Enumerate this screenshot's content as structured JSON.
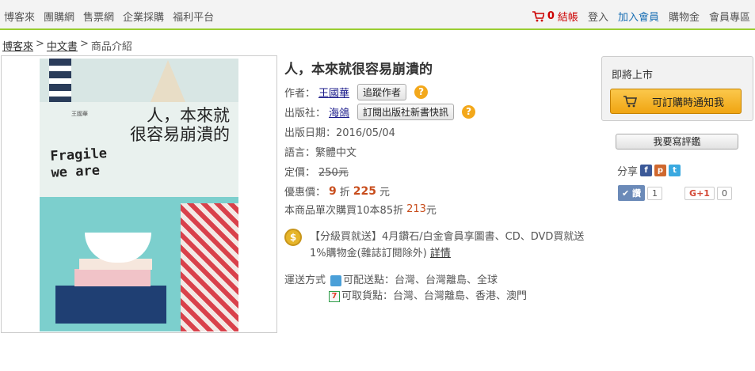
{
  "topnav": [
    "博客來",
    "團購網",
    "售票網",
    "企業採購",
    "福利平台"
  ],
  "usernav": {
    "cart_count": "0",
    "checkout": "結帳",
    "login": "登入",
    "join": "加入會員",
    "points": "購物金",
    "member_zone": "會員專區"
  },
  "breadcrumb": {
    "home": "博客來",
    "category": "中文書",
    "current": "商品介紹",
    "sep": ">"
  },
  "cover": {
    "title_line1": "人，本來就",
    "title_line2": "很容易崩潰的",
    "author": "王國華",
    "fragile_line1": "Fragile",
    "fragile_line2": "we are"
  },
  "product": {
    "title": "人，本來就很容易崩潰的",
    "author_label": "作者：",
    "author": "王國華",
    "track_author": "追蹤作者",
    "publisher_label": "出版社：",
    "publisher": "海鴿",
    "subscribe_publisher": "訂閱出版社新書快訊",
    "pubdate": "出版日期：2016/05/04",
    "language": "語言：繁體中文",
    "list_price_label": "定價：",
    "list_price": "250元",
    "sale_label": "優惠價：",
    "discount": "9",
    "discount_unit": "折",
    "sale_price": "225",
    "sale_unit": "元",
    "bulk_prefix": "本商品單次購買10本85折",
    "bulk_price": "213",
    "bulk_unit": "元",
    "help": "?"
  },
  "promo": {
    "coin": "$",
    "line1": "【分級買就送】4月鑽石/白金會員享圖書、CD、DVD買就送",
    "line2": "1%購物金(雜誌訂閱除外)",
    "details": "詳情"
  },
  "shipping": {
    "label": "運送方式",
    "delivery": "可配送點：台灣、台灣離島、全球",
    "pickup": "可取貨點：台灣、台灣離島、香港、澳門",
    "seven": "7"
  },
  "panel": {
    "title": "即將上市",
    "notify": "可訂購時通知我"
  },
  "review_button": "我要寫評鑑",
  "share": {
    "label": "分享",
    "fb": "f",
    "plurk": "p",
    "tw": "t"
  },
  "social": {
    "like_label": "✔ 讚",
    "like_count": "1",
    "gplus_label": "G+1",
    "gplus_count": "0"
  },
  "colors": {
    "accent_green": "#9acd32",
    "sale_orange": "#c84d1c",
    "notify_button": "#f0a512"
  }
}
